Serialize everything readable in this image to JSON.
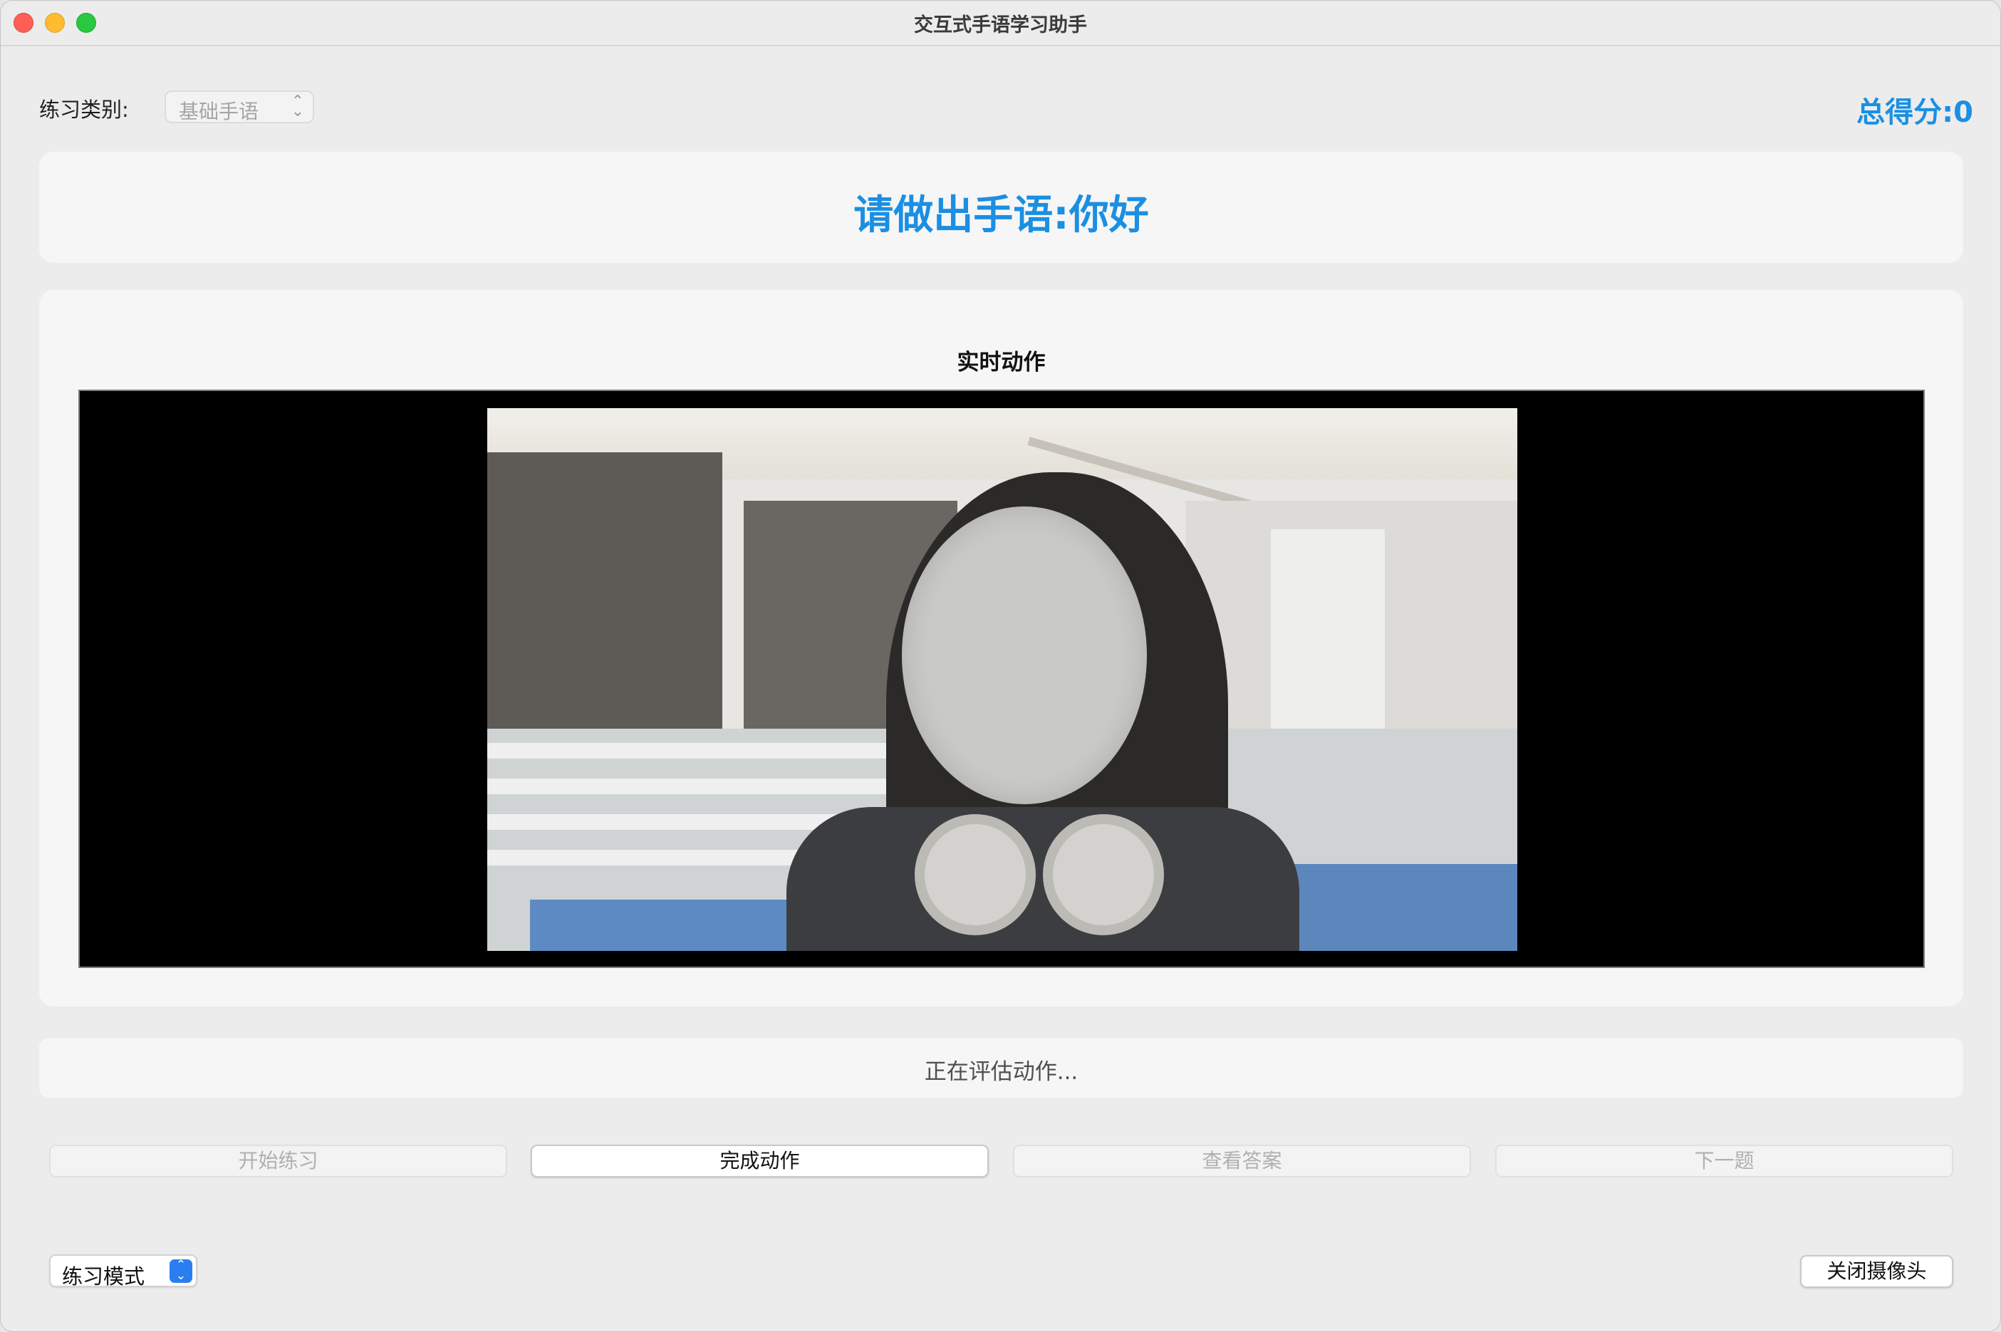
{
  "window": {
    "title": "交互式手语学习助手"
  },
  "toolbar": {
    "category_label": "练习类别:",
    "category_value": "基础手语",
    "score_label": "总得分:",
    "score_value": "0"
  },
  "prompt": {
    "text": "请做出手语:你好"
  },
  "video": {
    "title": "实时动作"
  },
  "status": {
    "text": "正在评估动作..."
  },
  "buttons": {
    "start": "开始练习",
    "finish": "完成动作",
    "answer": "查看答案",
    "next": "下一题"
  },
  "footer": {
    "mode_value": "练习模式",
    "camera_button": "关闭摄像头"
  },
  "colors": {
    "accent": "#1a8fe3",
    "control_blue": "#2a7ef0"
  },
  "icons": [
    "chevron-updown-icon",
    "stepper-icon"
  ]
}
